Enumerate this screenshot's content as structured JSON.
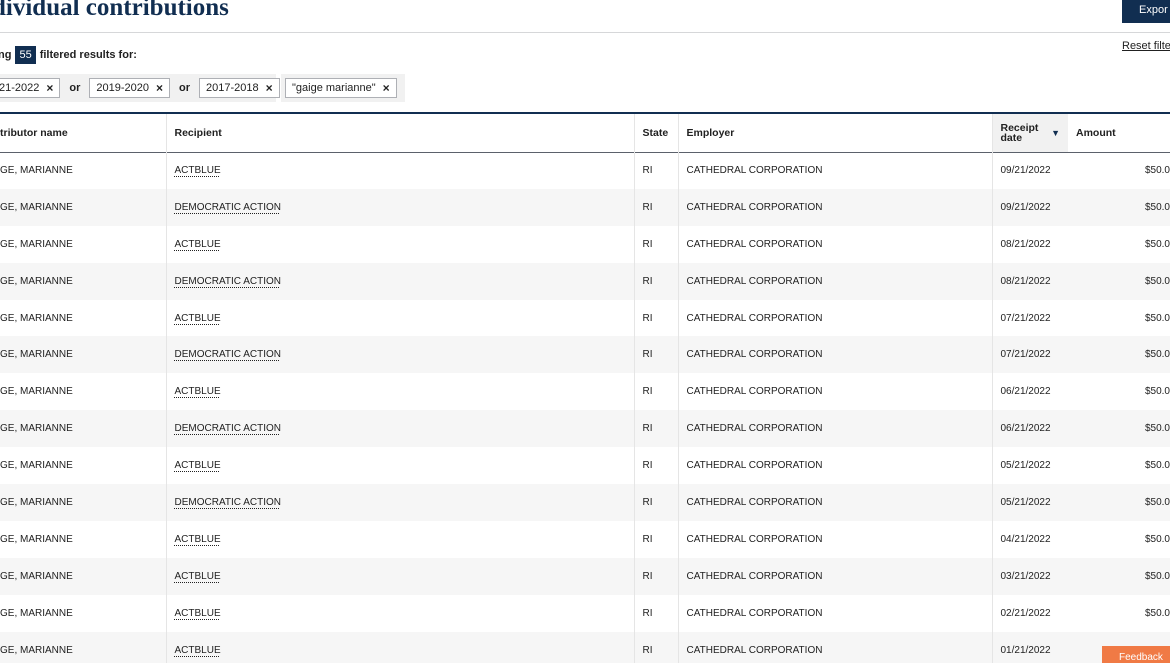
{
  "header": {
    "title": "dividual contributions",
    "export_label": "Expor",
    "reset_label": "Reset filte"
  },
  "summary": {
    "pre": "ng",
    "count": "55",
    "post": "filtered results for:"
  },
  "filters": {
    "group1": [
      {
        "label": "21-2022"
      },
      {
        "label": "2019-2020"
      },
      {
        "label": "2017-2018"
      }
    ],
    "or_label": "or",
    "group2": [
      {
        "label": "\"gaige marianne\""
      }
    ],
    "remove_glyph": "×"
  },
  "table": {
    "columns": {
      "contributor": "tributor name",
      "recipient": "Recipient",
      "state": "State",
      "employer": "Employer",
      "receipt_date": "Receipt date",
      "amount": "Amount",
      "sort_icon": "sort-descending-icon"
    },
    "rows": [
      {
        "contributor": "GE, MARIANNE",
        "recipient": "ACTBLUE",
        "state": "RI",
        "employer": "CATHEDRAL CORPORATION",
        "date": "09/21/2022",
        "amount": "$50.0"
      },
      {
        "contributor": "GE, MARIANNE",
        "recipient": "DEMOCRATIC ACTION",
        "state": "RI",
        "employer": "CATHEDRAL CORPORATION",
        "date": "09/21/2022",
        "amount": "$50.0"
      },
      {
        "contributor": "GE, MARIANNE",
        "recipient": "ACTBLUE",
        "state": "RI",
        "employer": "CATHEDRAL CORPORATION",
        "date": "08/21/2022",
        "amount": "$50.0"
      },
      {
        "contributor": "GE, MARIANNE",
        "recipient": "DEMOCRATIC ACTION",
        "state": "RI",
        "employer": "CATHEDRAL CORPORATION",
        "date": "08/21/2022",
        "amount": "$50.0"
      },
      {
        "contributor": "GE, MARIANNE",
        "recipient": "ACTBLUE",
        "state": "RI",
        "employer": "CATHEDRAL CORPORATION",
        "date": "07/21/2022",
        "amount": "$50.0"
      },
      {
        "contributor": "GE, MARIANNE",
        "recipient": "DEMOCRATIC ACTION",
        "state": "RI",
        "employer": "CATHEDRAL CORPORATION",
        "date": "07/21/2022",
        "amount": "$50.0"
      },
      {
        "contributor": "GE, MARIANNE",
        "recipient": "ACTBLUE",
        "state": "RI",
        "employer": "CATHEDRAL CORPORATION",
        "date": "06/21/2022",
        "amount": "$50.0"
      },
      {
        "contributor": "GE, MARIANNE",
        "recipient": "DEMOCRATIC ACTION",
        "state": "RI",
        "employer": "CATHEDRAL CORPORATION",
        "date": "06/21/2022",
        "amount": "$50.0"
      },
      {
        "contributor": "GE, MARIANNE",
        "recipient": "ACTBLUE",
        "state": "RI",
        "employer": "CATHEDRAL CORPORATION",
        "date": "05/21/2022",
        "amount": "$50.0"
      },
      {
        "contributor": "GE, MARIANNE",
        "recipient": "DEMOCRATIC ACTION",
        "state": "RI",
        "employer": "CATHEDRAL CORPORATION",
        "date": "05/21/2022",
        "amount": "$50.0"
      },
      {
        "contributor": "GE, MARIANNE",
        "recipient": "ACTBLUE",
        "state": "RI",
        "employer": "CATHEDRAL CORPORATION",
        "date": "04/21/2022",
        "amount": "$50.0"
      },
      {
        "contributor": "GE, MARIANNE",
        "recipient": "ACTBLUE",
        "state": "RI",
        "employer": "CATHEDRAL CORPORATION",
        "date": "03/21/2022",
        "amount": "$50.0"
      },
      {
        "contributor": "GE, MARIANNE",
        "recipient": "ACTBLUE",
        "state": "RI",
        "employer": "CATHEDRAL CORPORATION",
        "date": "02/21/2022",
        "amount": "$50.0"
      },
      {
        "contributor": "GE, MARIANNE",
        "recipient": "ACTBLUE",
        "state": "RI",
        "employer": "CATHEDRAL CORPORATION",
        "date": "01/21/2022",
        "amount": ""
      }
    ]
  },
  "feedback": {
    "label": "Feedback"
  },
  "colors": {
    "navy": "#112e51",
    "feedback": "#f07a45",
    "stripe": "#f6f6f6"
  }
}
